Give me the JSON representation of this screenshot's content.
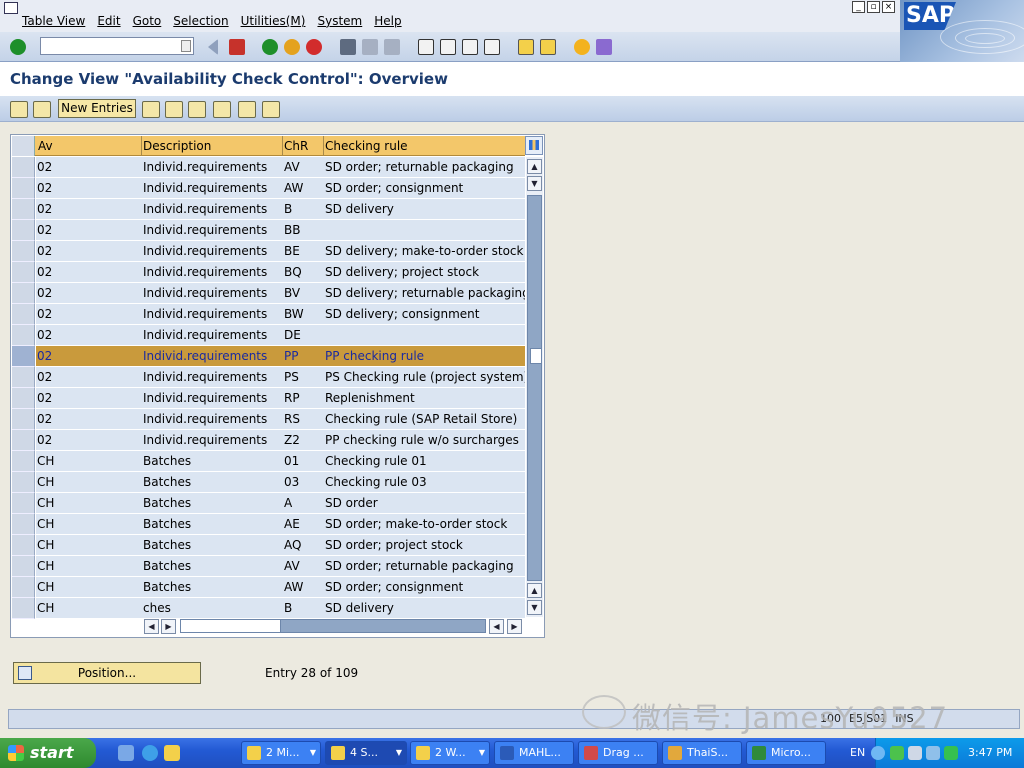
{
  "menubar": {
    "items": [
      "Table View",
      "Edit",
      "Goto",
      "Selection",
      "Utilities(M)",
      "System",
      "Help"
    ],
    "logo": "SAP"
  },
  "toolbar": {
    "command_value": "",
    "icons": [
      "enter-icon",
      "back-icon",
      "save-icon",
      "back-arrow-icon",
      "exit-icon",
      "cancel-icon",
      "print-icon",
      "find-icon",
      "find-next-icon",
      "first-page-icon",
      "prev-page-icon",
      "next-page-icon",
      "last-page-icon",
      "new-session-icon",
      "shortcut-icon",
      "help-icon",
      "layout-icon"
    ]
  },
  "page": {
    "title": "Change View \"Availability Check Control\": Overview"
  },
  "app_toolbar": {
    "new_entries_label": "New Entries"
  },
  "table": {
    "columns": [
      "Av",
      "Description",
      "ChR",
      "Checking rule"
    ],
    "rows": [
      {
        "av": "02",
        "desc": "Individ.requirements",
        "chr": "AV",
        "rule": "SD order; returnable packaging"
      },
      {
        "av": "02",
        "desc": "Individ.requirements",
        "chr": "AW",
        "rule": "SD order; consignment"
      },
      {
        "av": "02",
        "desc": "Individ.requirements",
        "chr": "B",
        "rule": "SD delivery"
      },
      {
        "av": "02",
        "desc": "Individ.requirements",
        "chr": "BB",
        "rule": ""
      },
      {
        "av": "02",
        "desc": "Individ.requirements",
        "chr": "BE",
        "rule": "SD delivery; make-to-order stock"
      },
      {
        "av": "02",
        "desc": "Individ.requirements",
        "chr": "BQ",
        "rule": "SD delivery; project stock"
      },
      {
        "av": "02",
        "desc": "Individ.requirements",
        "chr": "BV",
        "rule": "SD delivery; returnable packaging"
      },
      {
        "av": "02",
        "desc": "Individ.requirements",
        "chr": "BW",
        "rule": "SD delivery; consignment"
      },
      {
        "av": "02",
        "desc": "Individ.requirements",
        "chr": "DE",
        "rule": ""
      },
      {
        "av": "02",
        "desc": "Individ.requirements",
        "chr": "PP",
        "rule": "PP checking rule",
        "highlighted": true
      },
      {
        "av": "02",
        "desc": "Individ.requirements",
        "chr": "PS",
        "rule": "PS Checking rule (project system)"
      },
      {
        "av": "02",
        "desc": "Individ.requirements",
        "chr": "RP",
        "rule": "Replenishment"
      },
      {
        "av": "02",
        "desc": "Individ.requirements",
        "chr": "RS",
        "rule": "Checking rule (SAP Retail Store)"
      },
      {
        "av": "02",
        "desc": "Individ.requirements",
        "chr": "Z2",
        "rule": "PP checking rule w/o  surcharges"
      },
      {
        "av": "CH",
        "desc": "Batches",
        "chr": "01",
        "rule": "Checking rule 01"
      },
      {
        "av": "CH",
        "desc": "Batches",
        "chr": "03",
        "rule": "Checking rule 03"
      },
      {
        "av": "CH",
        "desc": "Batches",
        "chr": "A",
        "rule": "SD order"
      },
      {
        "av": "CH",
        "desc": "Batches",
        "chr": "AE",
        "rule": "SD order; make-to-order stock"
      },
      {
        "av": "CH",
        "desc": "Batches",
        "chr": "AQ",
        "rule": "SD order; project stock"
      },
      {
        "av": "CH",
        "desc": "Batches",
        "chr": "AV",
        "rule": "SD order; returnable packaging"
      },
      {
        "av": "CH",
        "desc": "Batches",
        "chr": "AW",
        "rule": "SD order; consignment"
      },
      {
        "av": "CH",
        "desc": "ches",
        "chr": "B",
        "rule": "SD delivery"
      }
    ]
  },
  "footer": {
    "position_label": "Position...",
    "entry_text": "Entry 28 of 109"
  },
  "statusbar": {
    "session_fields": [
      "100",
      "E5JS01",
      "INS"
    ],
    "watermark": "微信号: JamesYu9527"
  },
  "taskbar": {
    "start_label": "start",
    "tasks": [
      "2 Mi...",
      "4 S...",
      "2 W...",
      "MAHL...",
      "Drag ...",
      "ThaiS...",
      "Micro..."
    ],
    "language": "EN",
    "clock": "3:47 PM"
  },
  "colors": {
    "header_bg": "#f3c76a",
    "highlight_row": "#c99a3c",
    "row_bg": "#dbe5f2",
    "title_color": "#1b3b6e"
  }
}
